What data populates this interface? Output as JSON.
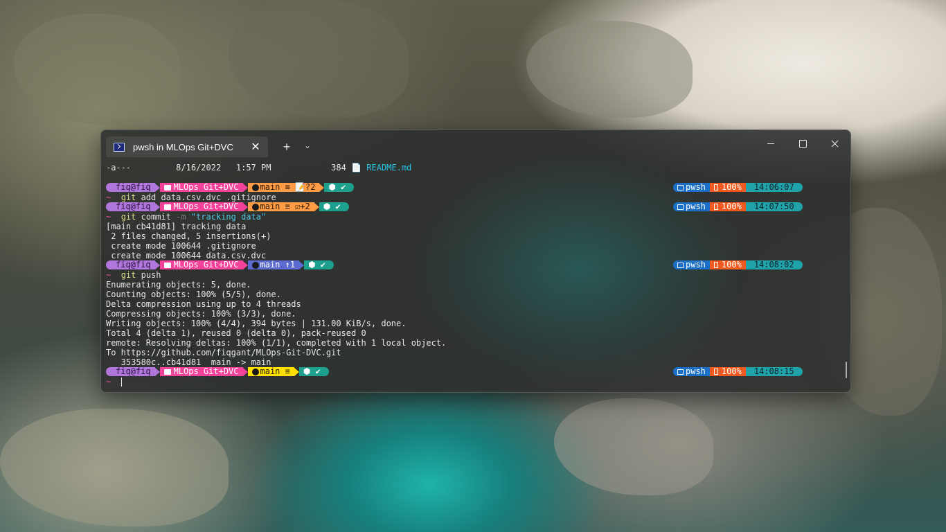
{
  "window": {
    "tab_title": "pwsh in MLOps Git+DVC",
    "tab_close": "✕",
    "new_tab": "+",
    "dropdown": "⌄"
  },
  "listing": {
    "mode": "-a---",
    "date": "8/16/2022",
    "time": "1:57 PM",
    "size": "384",
    "name": "README.md",
    "name_icon": "📄"
  },
  "prompts": [
    {
      "user": "fiq@fiq",
      "dir": "MLOps Git+DVC",
      "git": "main ≡ 📝?2",
      "node": "⬢ ✔",
      "shell": "pwsh",
      "battery": "100%",
      "time": "14:06:07",
      "command": "git",
      "args": " add data.csv.dvc .gitignore"
    },
    {
      "user": "fiq@fiq",
      "dir": "MLOps Git+DVC",
      "git": "main ≡ ☑+2",
      "node": "⬢ ✔",
      "shell": "pwsh",
      "battery": "100%",
      "time": "14:07:50",
      "command": "git",
      "args": " commit ",
      "flag": "-m",
      "string": " \"tracking data\""
    },
    {
      "user": "fiq@fiq",
      "dir": "MLOps Git+DVC",
      "git": "main ↑1",
      "node": "⬢ ✔",
      "shell": "pwsh",
      "battery": "100%",
      "time": "14:08:02",
      "command": "git",
      "args": " push"
    },
    {
      "user": "fiq@fiq",
      "dir": "MLOps Git+DVC",
      "git": "main ≡",
      "node": "⬢ ✔",
      "shell": "pwsh",
      "battery": "100%",
      "time": "14:08:15"
    }
  ],
  "tilde": "~",
  "commit_output": [
    "[main cb41d81] tracking data",
    " 2 files changed, 5 insertions(+)",
    " create mode 100644 .gitignore",
    " create mode 100644 data.csv.dvc"
  ],
  "push_output": [
    "Enumerating objects: 5, done.",
    "Counting objects: 100% (5/5), done.",
    "Delta compression using up to 4 threads",
    "Compressing objects: 100% (3/3), done.",
    "Writing objects: 100% (4/4), 394 bytes | 131.00 KiB/s, done.",
    "Total 4 (delta 1), reused 0 (delta 0), pack-reused 0",
    "remote: Resolving deltas: 100% (1/1), completed with 1 local object.",
    "To https://github.com/fiqgant/MLOps-Git-DVC.git",
    "   353580c..cb41d81  main -> main"
  ],
  "colors": {
    "user": "#b176dc",
    "dir": "#f2429a",
    "git_dirty": "#ff9a45",
    "git_ahead": "#5c6bd0",
    "git_clean": "#ffe000",
    "node": "#1ea08f",
    "shell": "#1b6fc6",
    "battery": "#f05a1e",
    "time": "#1fa3a8"
  },
  "icons": {
    "tab": "powershell-icon",
    "folder": "folder-icon",
    "github": "github-icon",
    "shell": "terminal-icon",
    "battery": "battery-icon"
  }
}
